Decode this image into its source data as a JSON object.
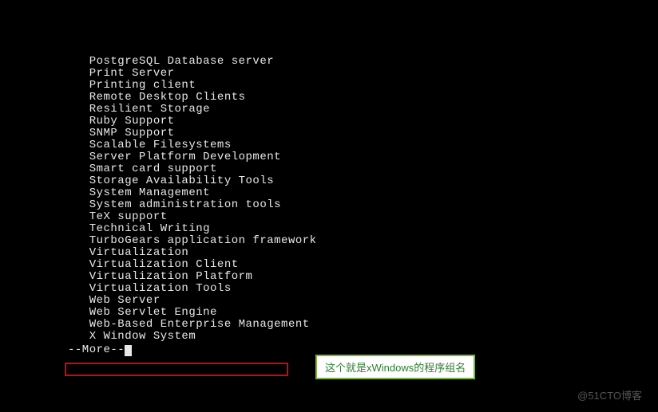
{
  "groups": [
    "PostgreSQL Database server",
    "Print Server",
    "Printing client",
    "Remote Desktop Clients",
    "Resilient Storage",
    "Ruby Support",
    "SNMP Support",
    "Scalable Filesystems",
    "Server Platform Development",
    "Smart card support",
    "Storage Availability Tools",
    "System Management",
    "System administration tools",
    "TeX support",
    "Technical Writing",
    "TurboGears application framework",
    "Virtualization",
    "Virtualization Client",
    "Virtualization Platform",
    "Virtualization Tools",
    "Web Server",
    "Web Servlet Engine",
    "Web-Based Enterprise Management",
    "X Window System"
  ],
  "pager": "--More--",
  "annotation_text": "这个就是xWindows的程序组名",
  "watermark_text": "@51CTO博客"
}
